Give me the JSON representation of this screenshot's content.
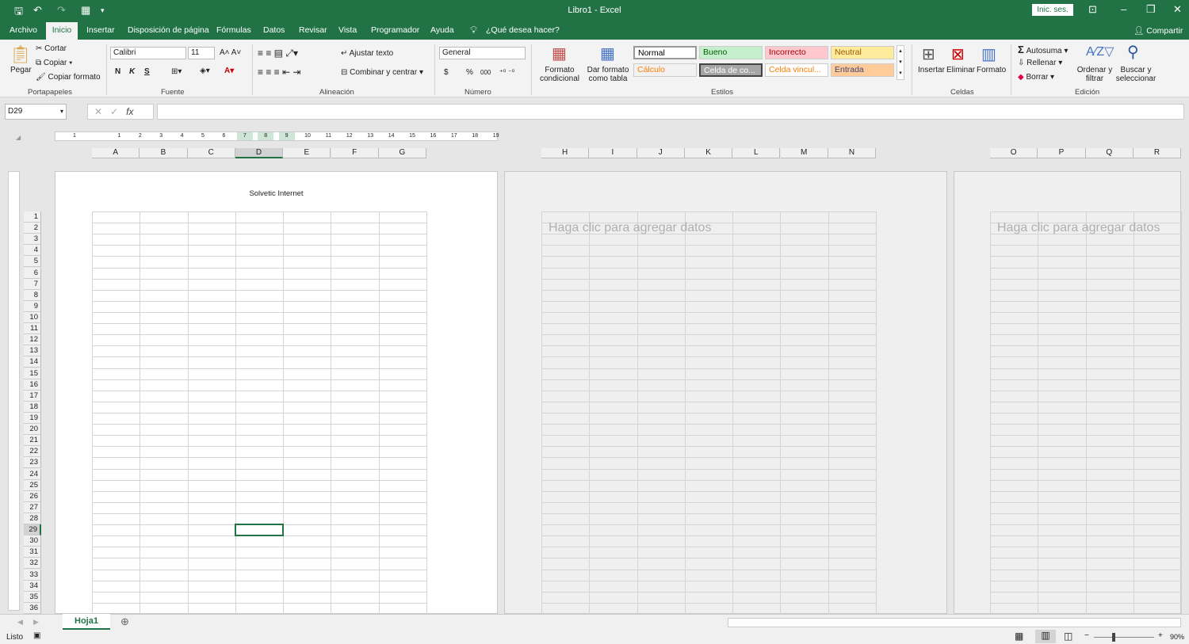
{
  "window": {
    "title": "Libro1  -  Excel",
    "signin": "Inic. ses.",
    "share": "Compartir"
  },
  "tabs": [
    "Archivo",
    "Inicio",
    "Insertar",
    "Disposición de página",
    "Fórmulas",
    "Datos",
    "Revisar",
    "Vista",
    "Programador",
    "Ayuda"
  ],
  "tell_me": "¿Qué desea hacer?",
  "clipboard": {
    "paste": "Pegar",
    "cut": "Cortar",
    "copy": "Copiar",
    "format_painter": "Copiar formato",
    "label": "Portapapeles"
  },
  "font": {
    "name": "Calibri",
    "size": "11",
    "bold": "N",
    "italic": "K",
    "underline": "S",
    "label": "Fuente"
  },
  "alignment": {
    "wrap": "Ajustar texto",
    "merge": "Combinar y centrar",
    "label": "Alineación"
  },
  "number": {
    "format": "General",
    "currency": "$",
    "percent": "%",
    "thousands": "000",
    "label": "Número"
  },
  "styles": {
    "cond_format": [
      "Formato",
      "condicional"
    ],
    "table_format": [
      "Dar formato",
      "como tabla"
    ],
    "label": "Estilos",
    "cells": [
      {
        "name": "Normal",
        "bg": "#ffffff",
        "fg": "#000000"
      },
      {
        "name": "Bueno",
        "bg": "#c6efce",
        "fg": "#006100"
      },
      {
        "name": "Incorrecto",
        "bg": "#ffc7ce",
        "fg": "#9c0006"
      },
      {
        "name": "Neutral",
        "bg": "#ffeb9c",
        "fg": "#9c5700"
      },
      {
        "name": "Cálculo",
        "bg": "#f2f2f2",
        "fg": "#fa7d00"
      },
      {
        "name": "Celda de co...",
        "bg": "#a5a5a5",
        "fg": "#ffffff"
      },
      {
        "name": "Celda vincul...",
        "bg": "#ffffff",
        "fg": "#fa7d00"
      },
      {
        "name": "Entrada",
        "bg": "#ffcc99",
        "fg": "#3f3f76"
      }
    ]
  },
  "cells_group": {
    "insert": "Insertar",
    "delete": "Eliminar",
    "format": "Formato",
    "label": "Celdas"
  },
  "editing": {
    "autosum": "Autosuma",
    "fill": "Rellenar",
    "clear": "Borrar",
    "sort": [
      "Ordenar y",
      "filtrar"
    ],
    "find": [
      "Buscar y",
      "seleccionar"
    ],
    "label": "Edición"
  },
  "formula_bar": {
    "name_box": "D29",
    "fx": "fx",
    "value": ""
  },
  "ruler": [
    "1",
    "1",
    "2",
    "3",
    "4",
    "5",
    "6",
    "7",
    "8",
    "9",
    "10",
    "11",
    "12",
    "13",
    "14",
    "15",
    "16",
    "17",
    "18",
    "19"
  ],
  "pages": [
    {
      "columns": [
        "A",
        "B",
        "C",
        "D",
        "E",
        "F",
        "G"
      ],
      "header": "Solvetic Internet"
    },
    {
      "columns": [
        "H",
        "I",
        "J",
        "K",
        "L",
        "M",
        "N"
      ],
      "placeholder": "Haga clic para agregar datos"
    },
    {
      "columns": [
        "O",
        "P",
        "Q",
        "R"
      ],
      "placeholder": "Haga clic para agregar datos"
    }
  ],
  "rows": [
    "1",
    "2",
    "3",
    "4",
    "5",
    "6",
    "7",
    "8",
    "9",
    "10",
    "11",
    "12",
    "13",
    "14",
    "15",
    "16",
    "17",
    "18",
    "19",
    "20",
    "21",
    "22",
    "23",
    "24",
    "25",
    "26",
    "27",
    "28",
    "29",
    "30",
    "31",
    "32",
    "33",
    "34",
    "35",
    "36"
  ],
  "selected_cell": {
    "column": "D",
    "row": "29"
  },
  "sheet_tab": "Hoja1",
  "status": {
    "ready": "Listo",
    "zoom": "90%",
    "zoom_percent": 90
  },
  "accent": "#217346"
}
